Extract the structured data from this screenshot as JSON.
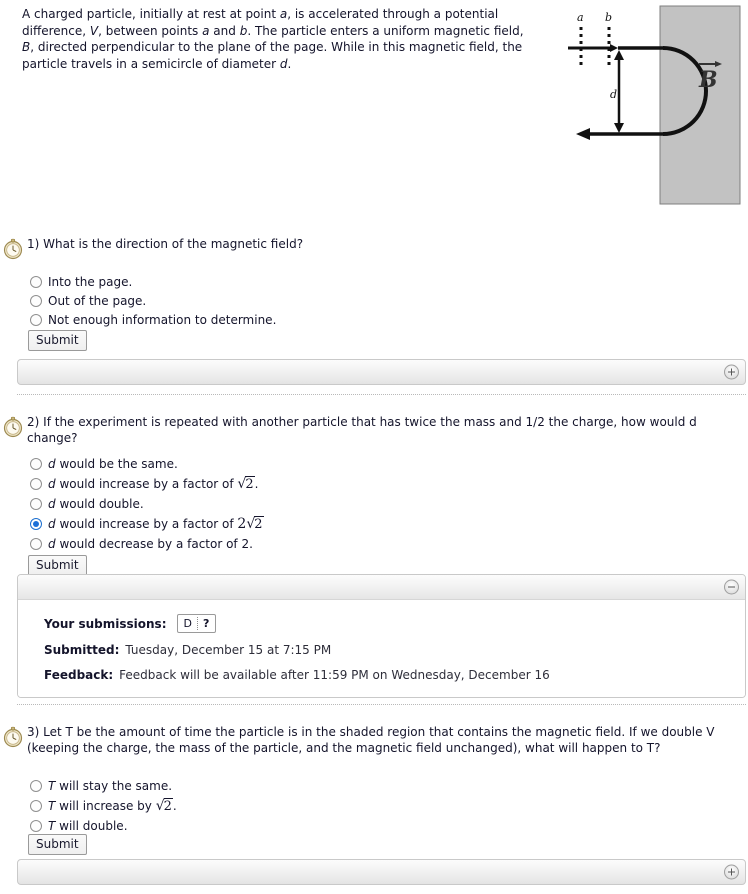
{
  "intro": {
    "text_parts": [
      "A charged particle, initially at rest at point ",
      "a",
      ", is accelerated through a potential difference, ",
      "V",
      ", between points ",
      "a",
      " and ",
      "b",
      ". The particle enters a uniform magnetic field, ",
      "B",
      ", directed perpendicular to the plane of the page. While in this magnetic field, the particle travels in a semicircle of diameter ",
      "d",
      "."
    ],
    "full_text": "A charged particle, initially at rest at point a, is accelerated through a potential difference, V, between points a and b. The particle enters a uniform magnetic field, B, directed perpendicular to the plane of the page. While in this magnetic field, the particle travels in a semicircle of diameter d."
  },
  "diagram": {
    "label_a": "a",
    "label_b": "b",
    "label_d": "d",
    "label_B": "B",
    "shaded_region_color": "#c2c2c2"
  },
  "questions": [
    {
      "number": "1)",
      "prompt": "What is the direction of the magnetic field?",
      "options": [
        {
          "label": "Into the page.",
          "selected": false
        },
        {
          "label": "Out of the page.",
          "selected": false
        },
        {
          "label": "Not enough information to determine.",
          "selected": false
        }
      ],
      "submit_label": "Submit"
    },
    {
      "number": "2)",
      "prompt": "If the experiment is repeated with another particle that has twice the mass and 1/2 the charge, how would d change?",
      "options": [
        {
          "label": "d would be the same.",
          "selected": false
        },
        {
          "label": "d would increase by a factor of √2.",
          "selected": false
        },
        {
          "label": "d would double.",
          "selected": false
        },
        {
          "label": "d would increase by a factor of 2√2",
          "selected": true
        },
        {
          "label": "d would decrease by a factor of 2.",
          "selected": false
        }
      ],
      "submit_label": "Submit"
    },
    {
      "number": "3)",
      "prompt": "Let T be the amount of time the particle is in the shaded region that contains the magnetic field. If we double V (keeping the charge, the mass of the particle, and the magnetic field unchanged), what will happen to T?",
      "options": [
        {
          "label": "T will stay the same.",
          "selected": false
        },
        {
          "label": "T will increase by √2.",
          "selected": false
        },
        {
          "label": "T will double.",
          "selected": false
        }
      ],
      "submit_label": "Submit"
    }
  ],
  "submissions_panel": {
    "submissions_label": "Your submissions:",
    "answer_chip": {
      "answer": "D",
      "status": "?"
    },
    "submitted_label": "Submitted:",
    "submitted_value": "Tuesday, December 15 at 7:15 PM",
    "feedback_label": "Feedback:",
    "feedback_value": "Feedback will be available after 11:59 PM on Wednesday, December 16"
  },
  "bars": {
    "expand_icon": "plus-icon",
    "collapse_icon": "minus-icon"
  }
}
